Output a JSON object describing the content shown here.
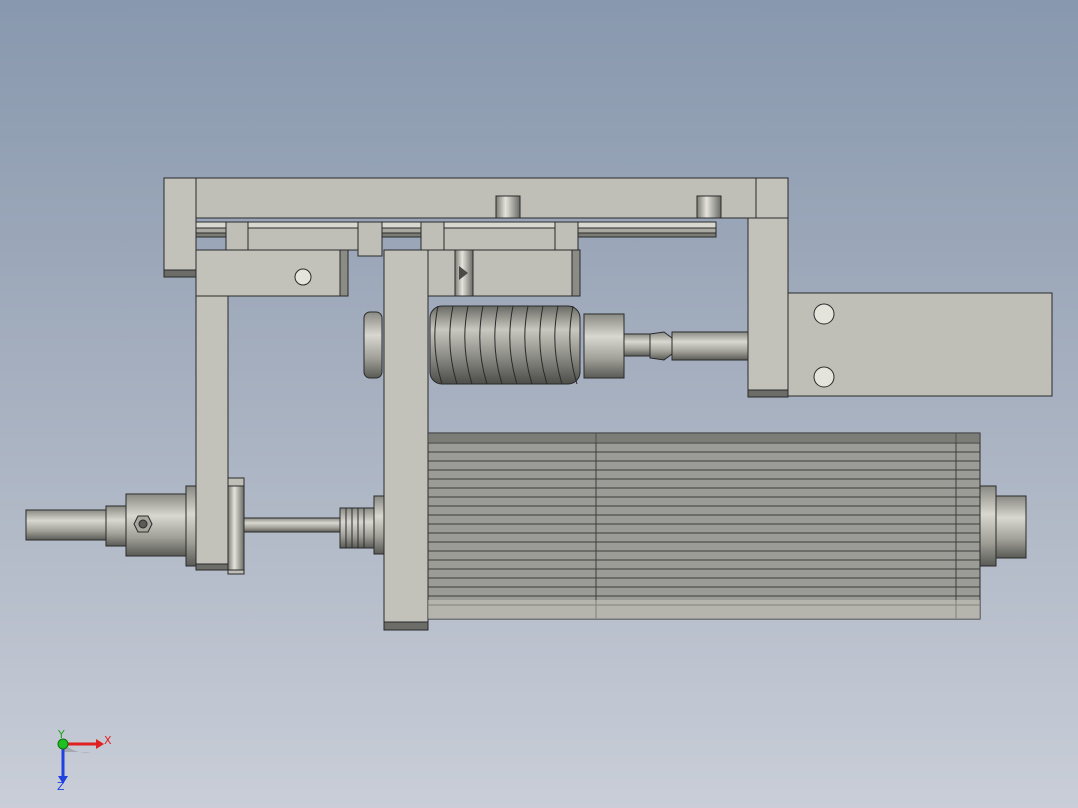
{
  "viewport": {
    "background_top": "#8898ae",
    "background_bottom": "#c9ced8",
    "part_fill": "#bfbfb7",
    "part_shade": "#6c6c68",
    "edge_color": "#2a2a2a"
  },
  "triad": {
    "x_label": "X",
    "y_label": "Y",
    "z_label": "Z",
    "x_color": "#e02020",
    "y_color": "#20c020",
    "z_color": "#2040e0"
  },
  "model": {
    "icons": [
      "bracket-plate",
      "guide-rail",
      "slide-blocks",
      "spring",
      "rod",
      "motor-body",
      "cylinder-fitting",
      "mounting-block"
    ]
  }
}
